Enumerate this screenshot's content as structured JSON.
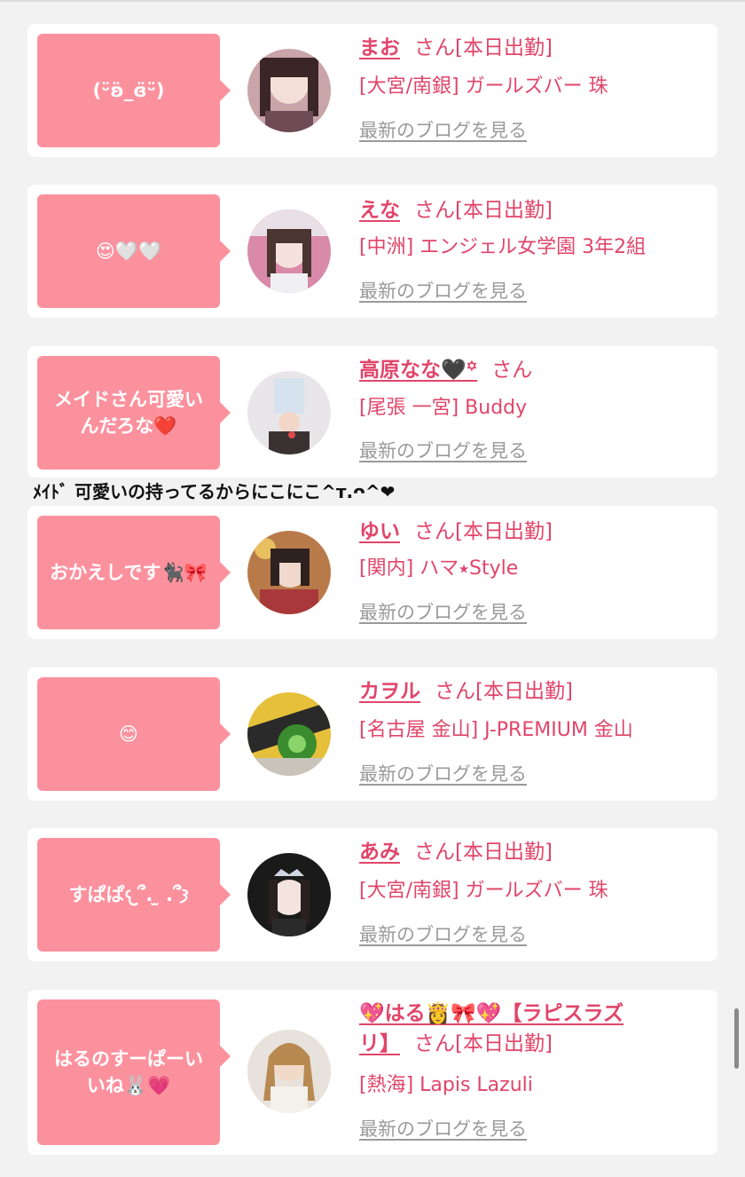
{
  "cards": [
    {
      "bubble": "(ᵕ̈ʚ̈_ɞ̈ᵕ̈)",
      "name": "まお",
      "san": "さん[本日出勤]",
      "shop": "[大宮/南銀] ガールズバー 珠",
      "blog": "最新のブログを見る"
    },
    {
      "bubble": "😍🤍🤍",
      "name": "えな",
      "san": "さん[本日出勤]",
      "shop": "[中洲] エンジェル女学園 3年2組",
      "blog": "最新のブログを見る"
    },
    {
      "bubble": "メイドさん可愛いんだろな❤️",
      "name": "高原なな🖤꙳",
      "san": "さん",
      "shop": "[尾張 一宮] Buddy",
      "blog": "最新のブログを見る"
    },
    {
      "bubble": "おかえしです🐈‍⬛🎀",
      "name": "ゆい",
      "san": "さん[本日出勤]",
      "shop": "[関内] ハマ⭑Style",
      "blog": "最新のブログを見る"
    },
    {
      "bubble": "😊",
      "name": "カヲル",
      "san": "さん[本日出勤]",
      "shop": "[名古屋 金山] J-PREMIUM 金山",
      "blog": "最新のブログを見る"
    },
    {
      "bubble": "すぱぱ𐔌՞. ̫ .՞𐦯",
      "name": "あみ",
      "san": "さん[本日出勤]",
      "shop": "[大宮/南銀] ガールズバー 珠",
      "blog": "最新のブログを見る"
    },
    {
      "bubble": "はるのすーぱーいいね🐰💗",
      "name_line1": "💖はる👸🎀💖【ラピスラズ",
      "name_line2": "リ】",
      "san": "さん[本日出勤]",
      "shop": "[熱海] Lapis Lazuli",
      "blog": "最新のブログを見る"
    }
  ],
  "overlay_text": "ﾒｲﾄﾞ 可愛いの持ってるからにこにこ^ᴛ.ᴖ^❤",
  "colors": {
    "accent": "#e1456a",
    "bubble": "#fc919e",
    "link_gray": "#9a9a9a"
  }
}
